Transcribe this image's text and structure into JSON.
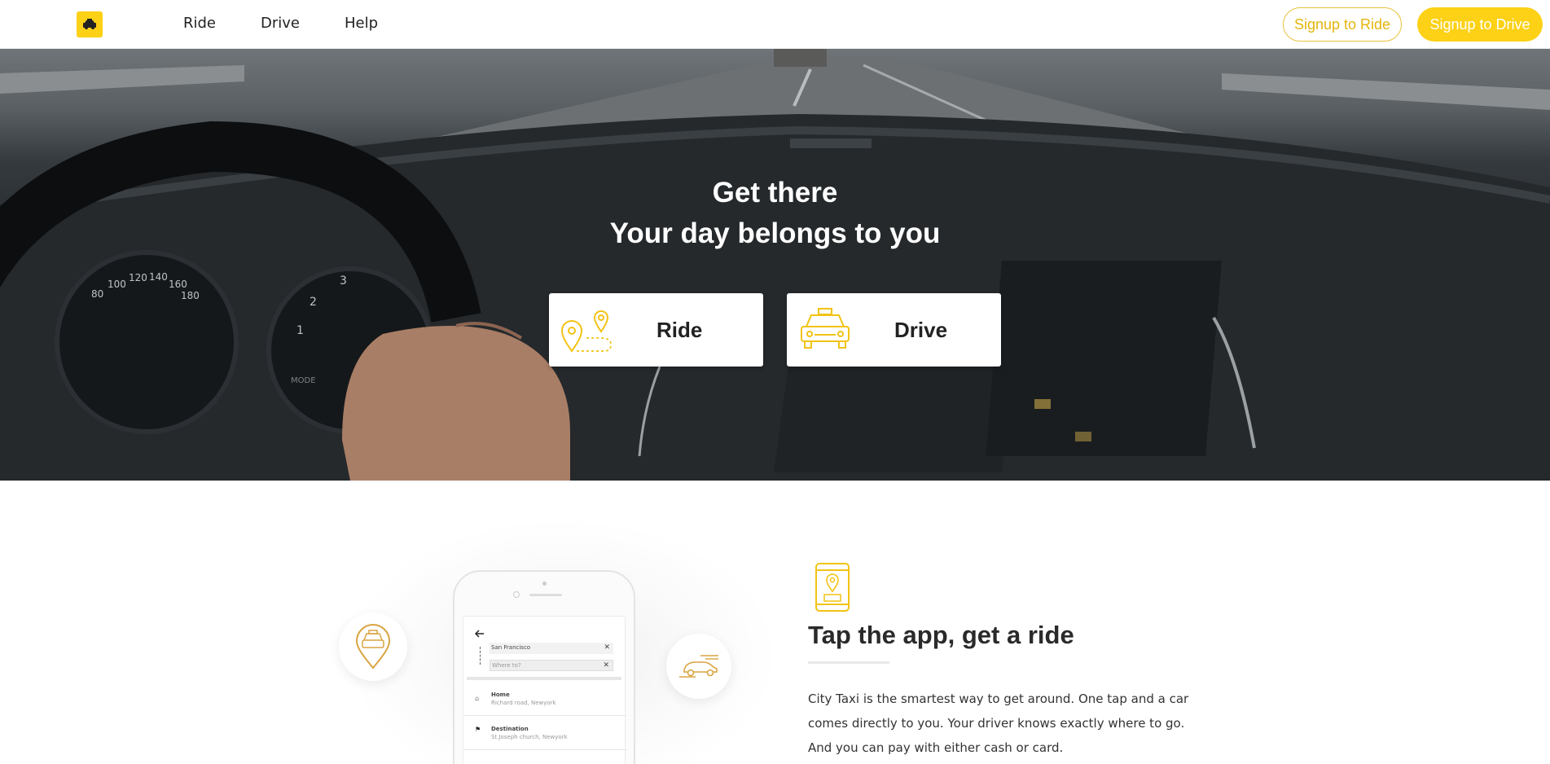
{
  "nav": {
    "logo_icon": "taxi-icon",
    "links": [
      "Ride",
      "Drive",
      "Help"
    ],
    "signup_ride": "Signup to Ride",
    "signup_drive": "Signup to Drive"
  },
  "hero": {
    "title_line1": "Get there",
    "title_line2": "Your day belongs to you",
    "cards": [
      {
        "label": "Ride",
        "icon": "map-pins-route-icon"
      },
      {
        "label": "Drive",
        "icon": "taxi-car-icon"
      }
    ],
    "gauge_labels": [
      "100",
      "120",
      "140",
      "160",
      "180",
      "80",
      "3",
      "2",
      "1",
      "MODE"
    ]
  },
  "feature": {
    "icon": "phone-taxi-icon",
    "title": "Tap the app, get a ride",
    "description": "City Taxi is the smartest way to get around. One tap and a car comes directly to you. Your driver knows exactly where to go. And you can pay with either cash or card.",
    "phone": {
      "from_value": "San Francisco",
      "to_placeholder": "Where to?",
      "items": [
        {
          "title": "Home",
          "subtitle": "Richard road, Newyork"
        },
        {
          "title": "Destination",
          "subtitle": "St.Joseph church, Newyork"
        }
      ]
    }
  },
  "colors": {
    "accent": "#fcd116",
    "accent_text": "#e3b50e"
  }
}
